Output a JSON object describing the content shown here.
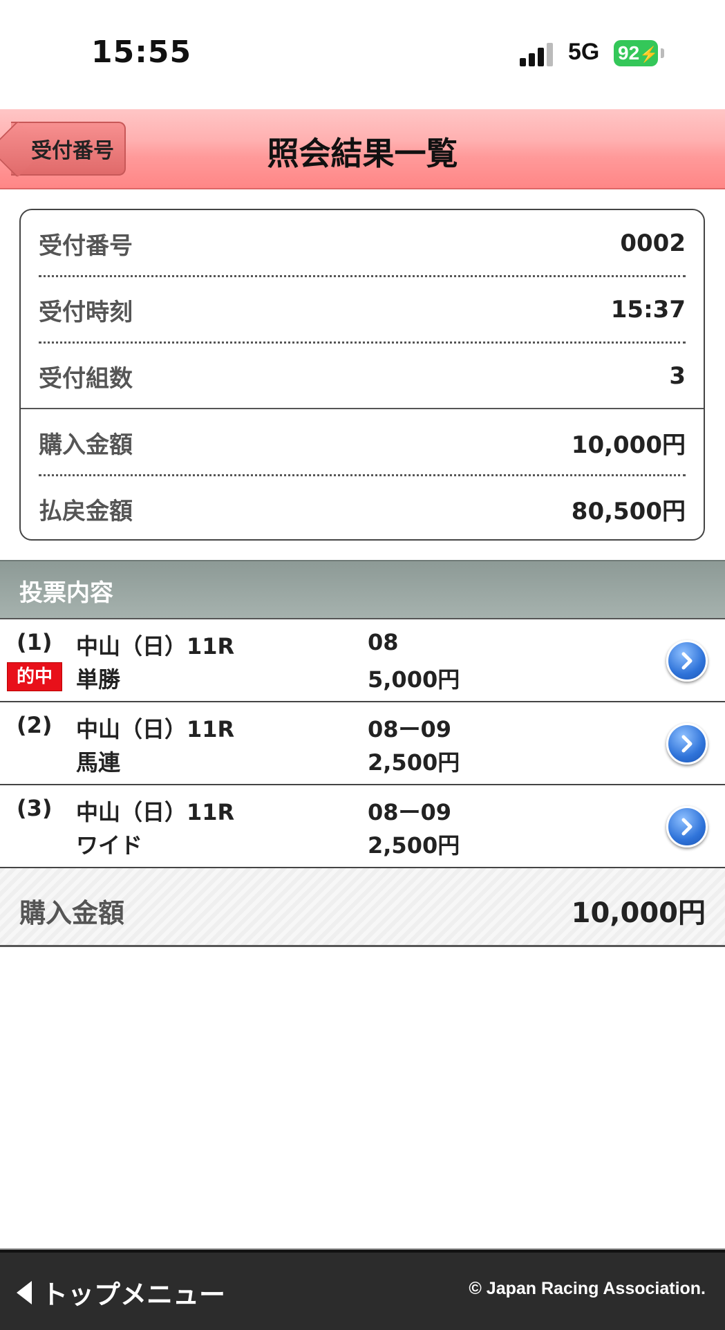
{
  "status_bar": {
    "time": "15:55",
    "network": "5G",
    "battery": "92"
  },
  "nav": {
    "back_label": "受付番号",
    "title": "照会結果一覧"
  },
  "info": [
    {
      "label": "受付番号",
      "value": "0002"
    },
    {
      "label": "受付時刻",
      "value": "15:37"
    },
    {
      "label": "受付組数",
      "value": "3"
    },
    {
      "label": "購入金額",
      "value": "10,000円"
    },
    {
      "label": "払戻金額",
      "value": "80,500円"
    }
  ],
  "section": {
    "title": "投票内容"
  },
  "bets": [
    {
      "num": "(1)",
      "badge": "的中",
      "race": "中山（日）11R",
      "type": "単勝",
      "combo": "08",
      "amount": "5,000円"
    },
    {
      "num": "(2)",
      "race": "中山（日）11R",
      "type": "馬連",
      "combo": "08ー09",
      "amount": "2,500円"
    },
    {
      "num": "(3)",
      "race": "中山（日）11R",
      "type": "ワイド",
      "combo": "08ー09",
      "amount": "2,500円"
    }
  ],
  "total": {
    "label": "購入金額",
    "value": "10,000円"
  },
  "footer": {
    "top_menu": "トップメニュー",
    "copyright": "© Japan Racing Association."
  },
  "colors": {
    "nav_pink": "#ff9a9a",
    "hit_red": "#e8101a",
    "chevron_blue": "#2f73d9",
    "footer_dark": "#2c2c2c",
    "battery_green": "#34c759"
  },
  "icons": {
    "back": "back-arrow-icon",
    "chevron": "chevron-right-icon",
    "signal": "cellular-signal-icon",
    "battery": "battery-icon",
    "footer_arrow": "left-triangle-icon"
  }
}
